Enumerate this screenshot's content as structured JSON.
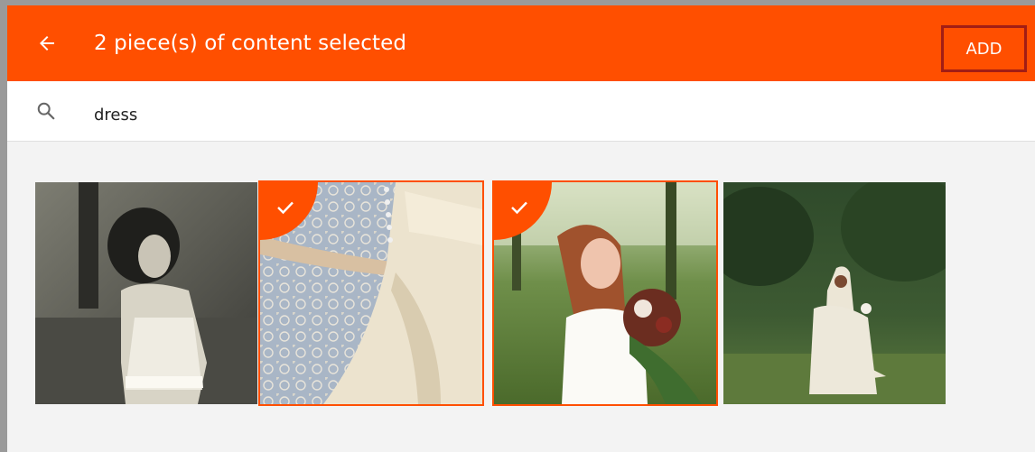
{
  "header": {
    "back_icon": "arrow-left-icon",
    "title": "2 piece(s) of content selected",
    "add_label": "ADD",
    "accent_color": "#ff4f00",
    "add_border_color": "#a21d15"
  },
  "search": {
    "icon": "search-icon",
    "value": "dress"
  },
  "results": [
    {
      "name": "photo-woman-bw-dress",
      "selected": false
    },
    {
      "name": "photo-lace-dress-closeup",
      "selected": true,
      "badge_icon": "check-icon"
    },
    {
      "name": "photo-bride-bouquet",
      "selected": true,
      "badge_icon": "check-icon"
    },
    {
      "name": "photo-bride-forest",
      "selected": false
    }
  ]
}
